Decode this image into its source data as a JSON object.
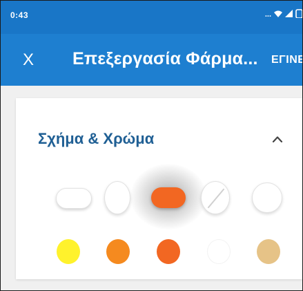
{
  "status_bar": {
    "time": "0:43",
    "dots": "...",
    "icons": [
      "wifi-icon",
      "signal-icon",
      "battery-icon"
    ]
  },
  "app_bar": {
    "close_label": "X",
    "title": "Επεξεργασία Φάρμα...",
    "action_label": "ΕΓΙΝΕ"
  },
  "section": {
    "title": "Σχήμα & Χρώμα",
    "collapse_icon": "chevron-up-icon"
  },
  "shapes": [
    {
      "name": "pill",
      "selected": false
    },
    {
      "name": "oval",
      "selected": false
    },
    {
      "name": "capsule",
      "selected": true,
      "color": "#f26722"
    },
    {
      "name": "scored-oval",
      "selected": false
    },
    {
      "name": "round",
      "selected": false
    }
  ],
  "colors": [
    "#fff22c",
    "#f58a1f",
    "#f26722",
    "#ffffff",
    "#e6c387"
  ],
  "theme": {
    "status_bar": "#1976c7",
    "app_bar": "#1e7fd0",
    "section_title": "#1f5f94"
  }
}
